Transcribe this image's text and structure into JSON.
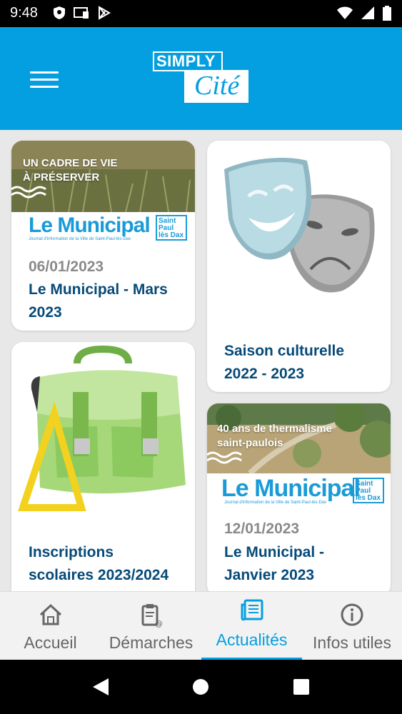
{
  "status_bar": {
    "time": "9:48"
  },
  "app_bar": {
    "logo_line1": "SIMPLY",
    "logo_line2": "Cité"
  },
  "cards": [
    {
      "photo_caption_line1": "UN CADRE DE VIE",
      "photo_caption_line2": "À PRÉSERVER",
      "masthead": "Le Municipal",
      "masthead_tagline": "Journal d'information de la Ville de Saint-Paul-lès-Dax",
      "badge_line1": "Saint",
      "badge_line2": "Paul",
      "badge_line3": "lès Dax",
      "date": "06/01/2023",
      "title_line1": "Le Municipal - Mars",
      "title_line2": "2023"
    },
    {
      "title_line1": "Saison culturelle",
      "title_line2": "2022 - 2023"
    },
    {
      "title_line1": "Inscriptions",
      "title_line2": "scolaires 2023/2024"
    },
    {
      "photo_caption_line1": "40 ans de thermalisme",
      "photo_caption_line2": "saint-paulois",
      "masthead": "Le Municipal",
      "masthead_tagline": "Journal d'information de la Ville de Saint-Paul-lès-Dax",
      "badge_line1": "Saint",
      "badge_line2": "Paul",
      "badge_line3": "lès Dax",
      "date": "12/01/2023",
      "title_line1": "Le Municipal -",
      "title_line2": "Janvier 2023"
    }
  ],
  "bottom_nav": [
    {
      "label": "Accueil",
      "icon": "home-icon",
      "active": false
    },
    {
      "label": "Démarches",
      "icon": "clipboard-icon",
      "active": false
    },
    {
      "label": "Actualités",
      "icon": "newspaper-icon",
      "active": true
    },
    {
      "label": "Infos utiles",
      "icon": "info-icon",
      "active": false
    }
  ],
  "colors": {
    "primary": "#049fe0",
    "title_text": "#064a78",
    "date_text": "#8a8a8a",
    "background": "#e8e8e8"
  }
}
